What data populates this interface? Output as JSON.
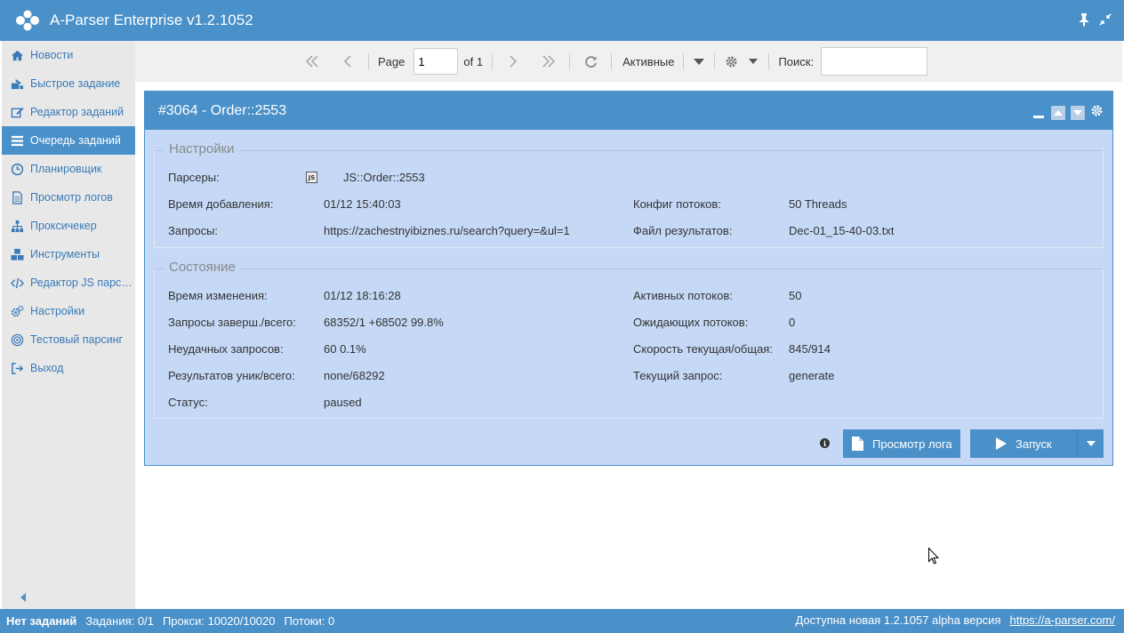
{
  "app": {
    "title": "A-Parser Enterprise v1.2.1052"
  },
  "sidebar": {
    "items": [
      {
        "label": "Новости",
        "icon": "home-icon",
        "active": false
      },
      {
        "label": "Быстрое задание",
        "icon": "quick-task-icon",
        "active": false
      },
      {
        "label": "Редактор заданий",
        "icon": "edit-icon",
        "active": false
      },
      {
        "label": "Очередь заданий",
        "icon": "list-icon",
        "active": true
      },
      {
        "label": "Планировщик",
        "icon": "clock-icon",
        "active": false
      },
      {
        "label": "Просмотр логов",
        "icon": "file-icon",
        "active": false
      },
      {
        "label": "Проксичекер",
        "icon": "sitemap-icon",
        "active": false
      },
      {
        "label": "Инструменты",
        "icon": "cubes-icon",
        "active": false
      },
      {
        "label": "Редактор JS парс…",
        "icon": "code-icon",
        "active": false
      },
      {
        "label": "Настройки",
        "icon": "gears-icon",
        "active": false
      },
      {
        "label": "Тестовый парсинг",
        "icon": "target-icon",
        "active": false
      },
      {
        "label": "Выход",
        "icon": "sign-out-icon",
        "active": false
      }
    ]
  },
  "toolbar": {
    "page_label": "Page",
    "page_value": "1",
    "of_label": "of 1",
    "filter_label": "Активные",
    "search_label": "Поиск:",
    "search_value": ""
  },
  "panel": {
    "title": "#3064 - Order::2553",
    "settings": {
      "legend": "Настройки",
      "parsers_label": "Парсеры:",
      "parser_badge": "JS",
      "parser_name": "JS::Order::2553",
      "added_label": "Время добавления:",
      "added_value": "01/12 15:40:03",
      "threads_cfg_label": "Конфиг потоков:",
      "threads_cfg_value": "50 Threads",
      "queries_label": "Запросы:",
      "queries_value": "https://zachestnyibiznes.ru/search?query=&ul=1",
      "result_file_label": "Файл результатов:",
      "result_file_value": "Dec-01_15-40-03.txt"
    },
    "state": {
      "legend": "Состояние",
      "changed_label": "Время изменения:",
      "changed_value": "01/12 18:16:28",
      "active_threads_label": "Активных потоков:",
      "active_threads_value": "50",
      "done_label": "Запросы заверш./всего:",
      "done_value": "68352/1 +68502 99.8%",
      "waiting_threads_label": "Ожидающих потоков:",
      "waiting_threads_value": "0",
      "failed_label": "Неудачных запросов:",
      "failed_value": "60 0.1%",
      "speed_label": "Скорость текущая/общая:",
      "speed_value": "845/914",
      "results_label": "Результатов уник/всего:",
      "results_value": "none/68292",
      "current_query_label": "Текущий запрос:",
      "current_query_value": "generate",
      "status_label": "Статус:",
      "status_value": "paused"
    },
    "view_log_label": "Просмотр лога",
    "start_label": "Запуск"
  },
  "statusbar": {
    "no_tasks": "Нет заданий",
    "tasks": "Задания: 0/1",
    "proxies": "Прокси: 10020/10020",
    "threads": "Потоки: 0",
    "update_text": "Доступна новая 1.2.1057 alpha версия",
    "update_link": "https://a-parser.com/"
  },
  "colors": {
    "accent": "#4a90c9",
    "panel_bg": "#c5d9f7",
    "sidebar_bg": "#e8e8e8"
  }
}
